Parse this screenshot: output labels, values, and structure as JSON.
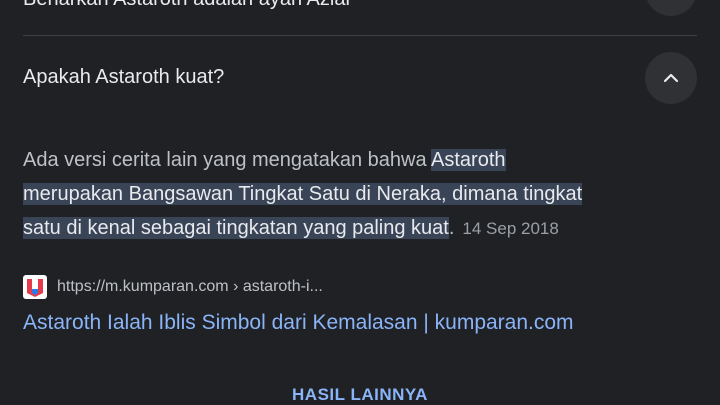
{
  "previous_item": {
    "question": "Benarkan Astaroth adalah ayah Azial"
  },
  "faq": {
    "question": "Apakah Astaroth kuat?",
    "answer_plain": "Ada versi cerita lain yang mengatakan bahwa ",
    "answer_highlight_1": "Astaroth",
    "answer_highlight_2": "merupakan Bangsawan Tingkat Satu di Neraka, dimana tingkat",
    "answer_highlight_3": "satu di kenal sebagai tingkatan yang paling kuat",
    "answer_end": ".",
    "date": "14 Sep 2018",
    "source_url": "https://m.kumparan.com › astaroth-i...",
    "result_title": "Astaroth Ialah Iblis Simbol dari Kemalasan | kumparan.com"
  },
  "more_results": {
    "label": "HASIL LAINNYA"
  },
  "icons": {
    "chevron": "chevron-up-icon",
    "favicon": "kumparan-favicon-icon"
  },
  "colors": {
    "background": "#202124",
    "text_primary": "#e8eaed",
    "text_secondary": "#bdc1c6",
    "link": "#8ab4f8",
    "highlight": "#394457",
    "favicon_red": "#e63b4d",
    "favicon_blue": "#2c7be5"
  }
}
